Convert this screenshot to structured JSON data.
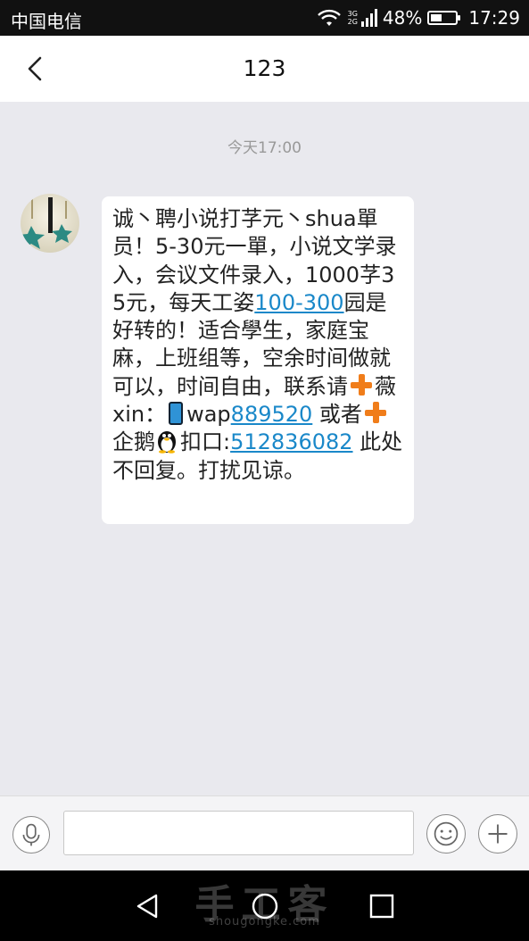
{
  "status_bar": {
    "carrier": "中国电信",
    "network_top": "3G",
    "network_bottom": "2G",
    "battery_percent": "48%",
    "battery_level": 0.48,
    "time": "17:29"
  },
  "header": {
    "title": "123",
    "back_icon": "chevron-left-icon"
  },
  "conversation": {
    "timestamp": "今天17:00",
    "message": {
      "segments": [
        {
          "type": "text",
          "text": "诚丶聘小说打芓元丶shua單员！5-30元一單，小说文学录入，会议文件录入，1000芓35元，每天工姿"
        },
        {
          "type": "link",
          "text": "100-300"
        },
        {
          "type": "text",
          "text": "园是好转的！适合學生，家庭宝麻，上班组等，空余时间做就可以，时间自由，联系请"
        },
        {
          "type": "emoji",
          "name": "plus-emoji"
        },
        {
          "type": "text",
          "text": "薇xin："
        },
        {
          "type": "emoji",
          "name": "phone-emoji"
        },
        {
          "type": "text",
          "text": "wap"
        },
        {
          "type": "link",
          "text": "889520"
        },
        {
          "type": "text",
          "text": " 或者"
        },
        {
          "type": "emoji",
          "name": "plus-emoji"
        },
        {
          "type": "text",
          "text": "企鹅"
        },
        {
          "type": "emoji",
          "name": "penguin-emoji"
        },
        {
          "type": "text",
          "text": "扣口:"
        },
        {
          "type": "link",
          "text": "512836082"
        },
        {
          "type": "text",
          "text": " 此处不回复。打扰见谅。"
        }
      ]
    }
  },
  "input_bar": {
    "voice_icon": "microphone-icon",
    "text_value": "",
    "emoji_icon": "smiley-icon",
    "add_icon": "plus-icon"
  },
  "nav_bar": {
    "back_icon": "triangle-back-icon",
    "home_icon": "circle-home-icon",
    "recents_icon": "square-recents-icon",
    "watermark": "手工客",
    "watermark_url": "shougongke.com"
  },
  "colors": {
    "link": "#1a88c9",
    "background": "#e9e9ee",
    "status_bar": "#111111",
    "emoji_plus": "#f07d1a"
  }
}
